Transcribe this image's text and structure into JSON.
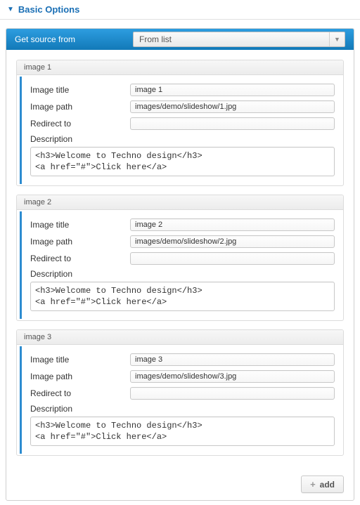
{
  "section_title": "Basic Options",
  "source": {
    "label": "Get source from",
    "selected": "From list"
  },
  "field_labels": {
    "title": "Image title",
    "path": "Image path",
    "redirect": "Redirect to",
    "description": "Description"
  },
  "items": [
    {
      "header": "image 1",
      "title": "image 1",
      "path": "images/demo/slideshow/1.jpg",
      "redirect": "",
      "description": "<h3>Welcome to Techno design</h3>\n<a href=\"#\">Click here</a>"
    },
    {
      "header": "image 2",
      "title": "image 2",
      "path": "images/demo/slideshow/2.jpg",
      "redirect": "",
      "description": "<h3>Welcome to Techno design</h3>\n<a href=\"#\">Click here</a>"
    },
    {
      "header": "image 3",
      "title": "image 3",
      "path": "images/demo/slideshow/3.jpg",
      "redirect": "",
      "description": "<h3>Welcome to Techno design</h3>\n<a href=\"#\">Click here</a>"
    }
  ],
  "add_button": "add"
}
